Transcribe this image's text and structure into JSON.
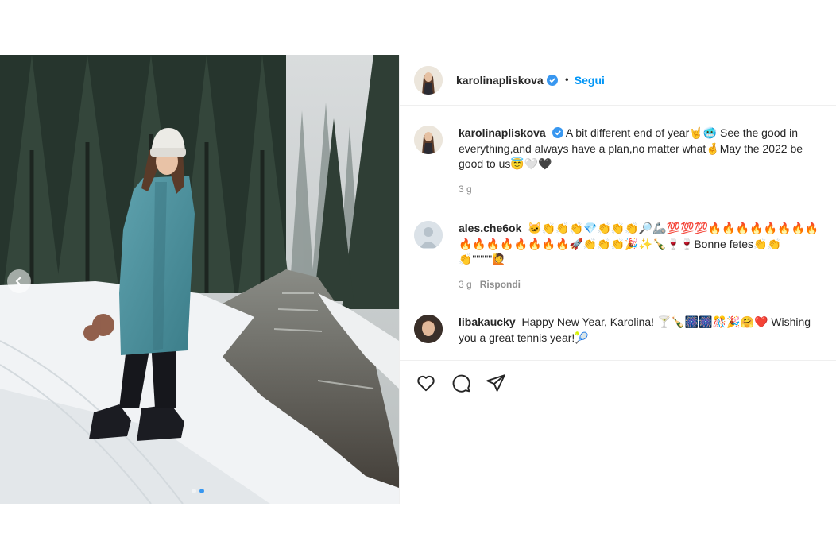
{
  "post": {
    "author": {
      "username": "karolinapliskova",
      "verified": true,
      "follow_label": "Segui",
      "separator": "•"
    },
    "caption": {
      "username": "karolinapliskova",
      "text": "A bit different end of year🤘🥶 See the good in everything,and always have a plan,no matter what🤞May the 2022 be good to us😇🤍🖤",
      "time": "3 g"
    },
    "comments": [
      {
        "username": "ales.che6ok",
        "text": "🐱👏👏👏💎👏👏👏🔎🦾💯💯💯🔥🔥🔥🔥🔥🔥🔥🔥🔥🔥🔥🔥🔥🔥🔥🔥🚀👏👏👏🎉✨🍾🍷🍷Bonne fetes👏👏👏\"\"\"\"\"🙋",
        "time": "3 g",
        "reply_label": "Rispondi"
      },
      {
        "username": "libakaucky",
        "text": "Happy New Year, Karolina! 🍸🍾🎆🎆🎊🎉🤗❤️ Wishing you a great tennis year!🎾"
      }
    ],
    "carousel": {
      "slides": 2,
      "current": 2
    },
    "icons": [
      "heart-icon",
      "comment-icon",
      "share-icon",
      "chevron-left-icon",
      "verified-badge-icon"
    ],
    "colors": {
      "accent": "#0095f6",
      "verified": "#3897f0",
      "text": "#262626",
      "muted": "#8e8e8e",
      "border": "#efefef"
    }
  }
}
